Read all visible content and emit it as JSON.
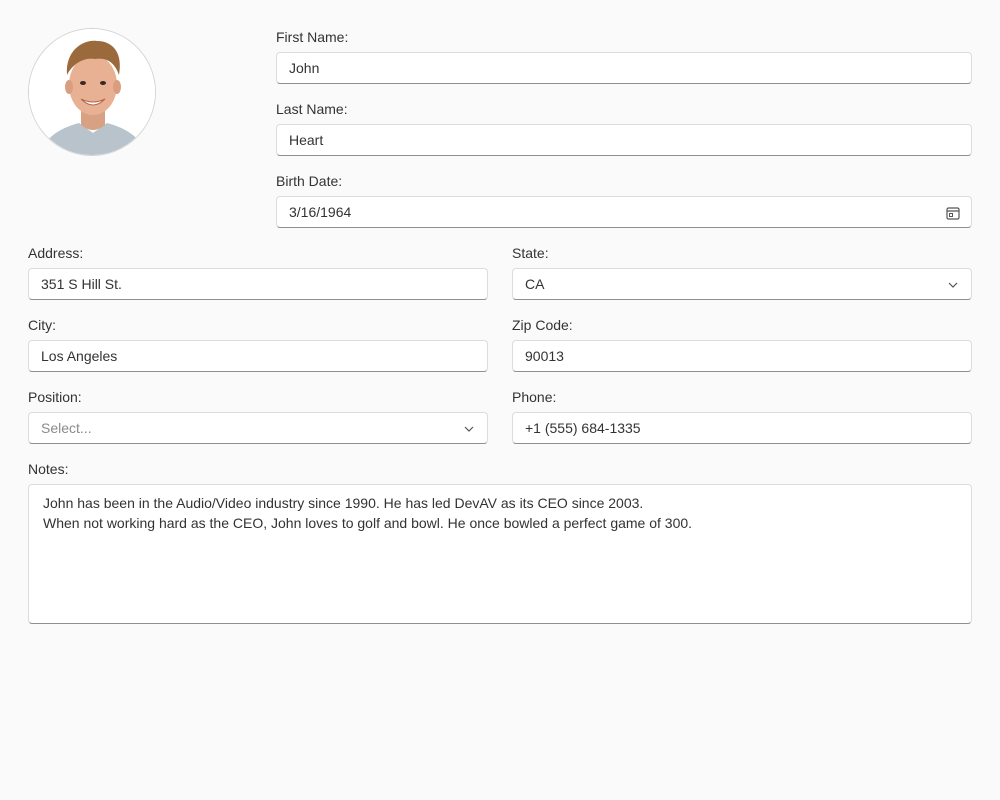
{
  "employee": {
    "first_name": {
      "label": "First Name:",
      "value": "John"
    },
    "last_name": {
      "label": "Last Name:",
      "value": "Heart"
    },
    "birth_date": {
      "label": "Birth Date:",
      "value": "3/16/1964",
      "icon": "calendar-icon"
    },
    "address": {
      "label": "Address:",
      "value": "351 S Hill St."
    },
    "state": {
      "label": "State:",
      "value": "CA",
      "icon": "chevron-down-icon"
    },
    "city": {
      "label": "City:",
      "value": "Los Angeles"
    },
    "zip": {
      "label": "Zip Code:",
      "value": "90013"
    },
    "position": {
      "label": "Position:",
      "placeholder": "Select...",
      "icon": "chevron-down-icon"
    },
    "phone": {
      "label": "Phone:",
      "value": "+1 (555) 684-1335"
    },
    "notes": {
      "label": "Notes:",
      "lines": [
        "John has been in the Audio/Video industry since 1990. He has led DevAV as its CEO since 2003.",
        "When not working hard as the CEO, John loves to golf and bowl. He once bowled a perfect game of 300."
      ]
    }
  }
}
